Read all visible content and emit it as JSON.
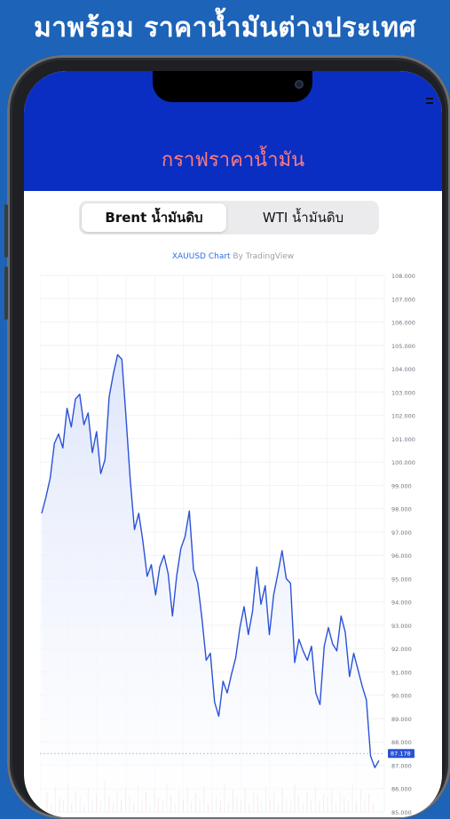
{
  "promo": {
    "title": "มาพร้อม ราคาน้ำมันต่างประเทศ"
  },
  "header": {
    "title": "กราฟราคาน้ำมัน"
  },
  "tabs": [
    {
      "label": "Brent น้ำมันดิบ",
      "selected": true
    },
    {
      "label": "WTI น้ำมันดิบ",
      "selected": false
    }
  ],
  "attribution": {
    "symbol": "XAUUSD Chart",
    "by": " By TradingView"
  },
  "colors": {
    "header_bg": "#0b2ec2",
    "title_color": "#ff7b7b",
    "line": "#2a52d6",
    "fill": "#dfe6fb",
    "price_tag": "#2a52d6"
  },
  "chart_data": {
    "type": "area",
    "title": "",
    "ylim": [
      85,
      108
    ],
    "y_ticks": [
      "85.000",
      "86.000",
      "87.000",
      "88.000",
      "89.000",
      "90.000",
      "91.000",
      "92.000",
      "93.000",
      "94.000",
      "95.000",
      "96.000",
      "97.000",
      "98.000",
      "99.000",
      "100.000",
      "101.000",
      "102.000",
      "103.000",
      "104.000",
      "105.000",
      "106.000",
      "107.000",
      "108.000"
    ],
    "last_price_label": "87.178",
    "series": [
      {
        "values": [
          97.8,
          98.5,
          99.3,
          100.8,
          101.2,
          100.6,
          102.3,
          101.5,
          102.7,
          102.9,
          101.6,
          102.1,
          100.4,
          101.3,
          99.5,
          100.1,
          102.8,
          103.8,
          104.6,
          104.4,
          101.9,
          99.2,
          97.1,
          97.8,
          96.6,
          95.1,
          95.6,
          94.3,
          95.5,
          96.0,
          95.2,
          93.4,
          95.1,
          96.3,
          96.8,
          97.9,
          95.4,
          94.8,
          93.3,
          91.5,
          91.8,
          89.7,
          89.1,
          90.6,
          90.1,
          90.9,
          91.6,
          92.9,
          93.8,
          92.6,
          93.6,
          95.5,
          93.9,
          94.7,
          92.6,
          94.3,
          95.2,
          96.2,
          95.0,
          94.8,
          91.4,
          92.4,
          91.9,
          91.5,
          92.1,
          90.1,
          89.6,
          92.1,
          92.9,
          92.2,
          91.9,
          93.4,
          92.7,
          90.8,
          91.8,
          91.1,
          90.4,
          89.8,
          87.4,
          86.9,
          87.2
        ]
      }
    ],
    "volume_bars": [
      0.42,
      0.18,
      0.55,
      0.3,
      0.25,
      0.6,
      0.2,
      0.45,
      0.35,
      0.15,
      0.5,
      0.28,
      0.4,
      0.22,
      0.65,
      0.33,
      0.19,
      0.48,
      0.26,
      0.52,
      0.37,
      0.21,
      0.58,
      0.29,
      0.44,
      0.17,
      0.5,
      0.31,
      0.24,
      0.62,
      0.36,
      0.2,
      0.47,
      0.27,
      0.54,
      0.23,
      0.4,
      0.3,
      0.56,
      0.18,
      0.43,
      0.34,
      0.25,
      0.6,
      0.21,
      0.49,
      0.32,
      0.26,
      0.53,
      0.2,
      0.41,
      0.38,
      0.22,
      0.57,
      0.28,
      0.46,
      0.19,
      0.51,
      0.3,
      0.24,
      0.59,
      0.35,
      0.2,
      0.44,
      0.27,
      0.55,
      0.23,
      0.39,
      0.31,
      0.5,
      0.18,
      0.45,
      0.33,
      0.26,
      0.61,
      0.22,
      0.48,
      0.29,
      0.4,
      0.2
    ]
  }
}
